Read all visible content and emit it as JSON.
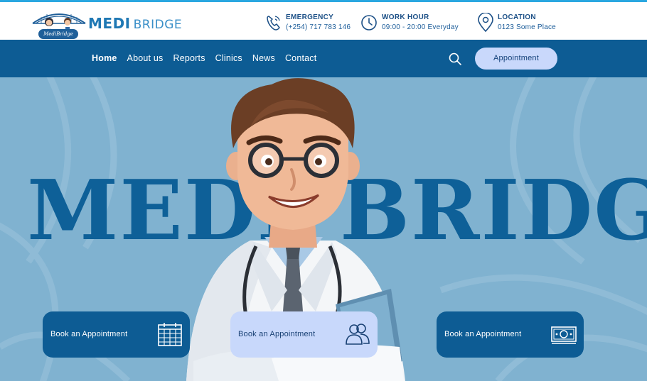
{
  "brand": {
    "name_bold": "MEDI",
    "name_light": "BRIDGE",
    "badge": "MediBridge"
  },
  "contact": [
    {
      "icon": "phone-icon",
      "label": "EMERGENCY",
      "value": "(+254) 717 783 146"
    },
    {
      "icon": "clock-icon",
      "label": "WORK HOUR",
      "value": "09:00 - 20:00 Everyday"
    },
    {
      "icon": "location-pin-icon",
      "label": "LOCATION",
      "value": "0123 Some Place"
    }
  ],
  "nav": {
    "items": [
      "Home",
      "About us",
      "Reports",
      "Clinics",
      "News",
      "Contact"
    ],
    "active": "Home",
    "appointment_label": "Appointment"
  },
  "hero": {
    "word_left": "MEDI",
    "word_right": "BRIDGE"
  },
  "cards": [
    {
      "label": "Book an Appointment",
      "icon": "calendar-icon",
      "style": "dark"
    },
    {
      "label": "Book an Appointment",
      "icon": "people-icon",
      "style": "light"
    },
    {
      "label": "Book an Appointment",
      "icon": "money-icon",
      "style": "dark"
    }
  ],
  "colors": {
    "accent": "#0d5c94",
    "light_accent": "#c9d8fb",
    "hero_bg": "#80b2d0",
    "top_line": "#2aa7e0"
  }
}
